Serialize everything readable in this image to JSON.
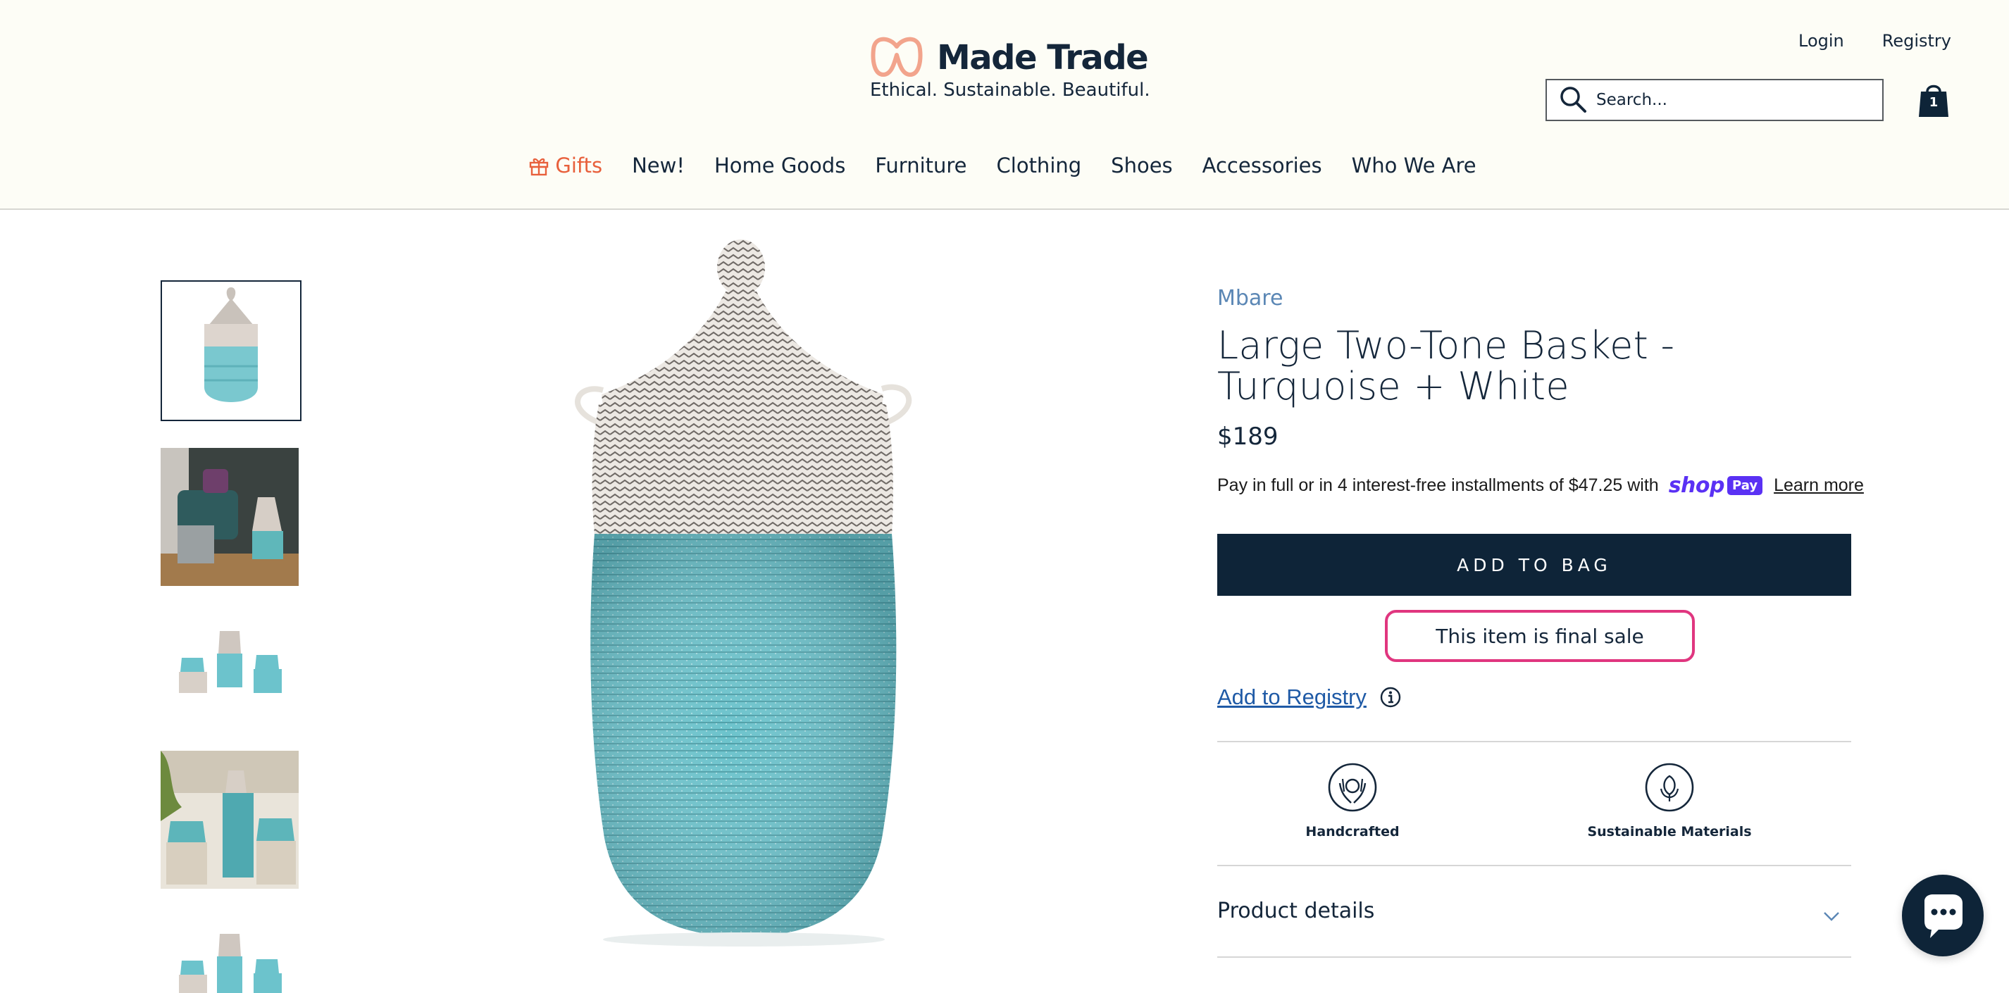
{
  "header": {
    "logo": {
      "name": "Made Trade",
      "tagline": "Ethical. Sustainable. Beautiful."
    },
    "top_links": {
      "login": "Login",
      "registry": "Registry"
    },
    "search": {
      "placeholder": "Search..."
    },
    "bag": {
      "count": "1"
    },
    "nav": [
      "Gifts",
      "New!",
      "Home Goods",
      "Furniture",
      "Clothing",
      "Shoes",
      "Accessories",
      "Who We Are"
    ]
  },
  "gallery": {
    "thumbnail_count": 5,
    "active_thumbnail": 0
  },
  "product": {
    "brand": "Mbare",
    "title": "Large Two-Tone Basket - Turquoise + White",
    "price": "$189",
    "installments_text": "Pay in full or in 4 interest-free installments of $47.25 with",
    "shop_pay": {
      "shop": "shop",
      "pay": "Pay"
    },
    "learn_more": "Learn more",
    "add_to_bag": "ADD TO BAG",
    "final_sale": "This item is final sale",
    "add_to_registry": "Add to Registry",
    "features": [
      {
        "label": "Handcrafted",
        "icon": "handcrafted-icon"
      },
      {
        "label": "Sustainable Materials",
        "icon": "sustainable-materials-icon"
      }
    ],
    "accordion": {
      "product_details": "Product details"
    }
  },
  "colors": {
    "navy": "#0e2438",
    "gifts_accent": "#e8603c",
    "brand_link": "#5b87b5",
    "final_sale_border": "#e0367f",
    "shop_pay": "#5a31f4",
    "turquoise": "#6cc3cc"
  }
}
